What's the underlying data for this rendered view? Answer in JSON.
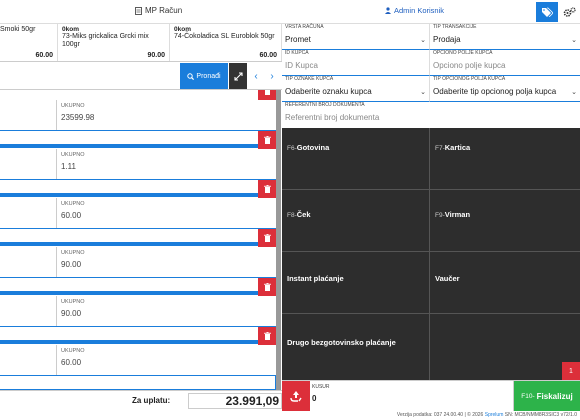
{
  "topbar": {
    "document_label": "MP Račun",
    "user_label": "Admin Korisnik"
  },
  "products": [
    {
      "qty": "",
      "name": "Smoki 50gr",
      "price": "60.00"
    },
    {
      "qty": "0kom",
      "name": "73-Miks grickalica Grcki mix 100gr",
      "price": "90.00"
    },
    {
      "qty": "0kom",
      "name": "74-Čokoladica SL Euroblok 50gr",
      "price": "60.00"
    }
  ],
  "search": {
    "button_label": "Pronađi"
  },
  "cart_rows": [
    {
      "label": "UKUPNO",
      "value": "23599.98"
    },
    {
      "label": "UKUPNO",
      "value": "1.11"
    },
    {
      "label": "UKUPNO",
      "value": "60.00"
    },
    {
      "label": "UKUPNO",
      "value": "90.00"
    },
    {
      "label": "UKUPNO",
      "value": "90.00"
    },
    {
      "label": "UKUPNO",
      "value": "60.00"
    }
  ],
  "total": {
    "label": "Za uplatu:",
    "value": "23.991,09"
  },
  "form": {
    "vrsta_racuna": {
      "label": "VRSTA RAČUNA",
      "value": "Promet"
    },
    "tip_transakcije": {
      "label": "TIP TRANSAKCIJE",
      "value": "Prodaja"
    },
    "id_kupca": {
      "label": "ID KUPCA",
      "placeholder": "ID Kupca"
    },
    "opciono_polje": {
      "label": "OPCIONO POLJE KUPCA",
      "placeholder": "Opciono polje kupca"
    },
    "tip_oznake": {
      "label": "TIP OZNAKE KUPCA",
      "value": "Odaberite oznaku kupca"
    },
    "tip_opcionog": {
      "label": "TIP OPCIONOG POLJA KUPCA",
      "value": "Odaberite tip opcionog polja kupca"
    },
    "referentni": {
      "label": "REFERENTNI BROJ DOKUMENTA",
      "placeholder": "Referentni broj dokumenta"
    }
  },
  "payments": [
    {
      "key": "F6-",
      "name": "Gotovina"
    },
    {
      "key": "F7-",
      "name": "Kartica"
    },
    {
      "key": "F8-",
      "name": "Ček"
    },
    {
      "key": "F9-",
      "name": "Virman"
    },
    {
      "key": "",
      "name": "Instant plaćanje"
    },
    {
      "key": "",
      "name": "Vaučer"
    },
    {
      "key": "",
      "name": "Drugo bezgotovinsko plaćanje"
    }
  ],
  "kusur": {
    "label": "KUSUR",
    "value": "0"
  },
  "fiskal": {
    "key": "F10-",
    "label": "Fiskalizuj"
  },
  "badge": "1",
  "footer": {
    "text_before": "Verzija podatka: 037 24.00.40 | © 2026",
    "link": "Sprelum",
    "text_after": "SN: MCB/NMM8R3SIC3 v72/1.0"
  },
  "colors": {
    "accent": "#1a7ddb",
    "danger": "#dc2f3a",
    "success": "#2db34a",
    "dark": "#2d2d2d"
  }
}
